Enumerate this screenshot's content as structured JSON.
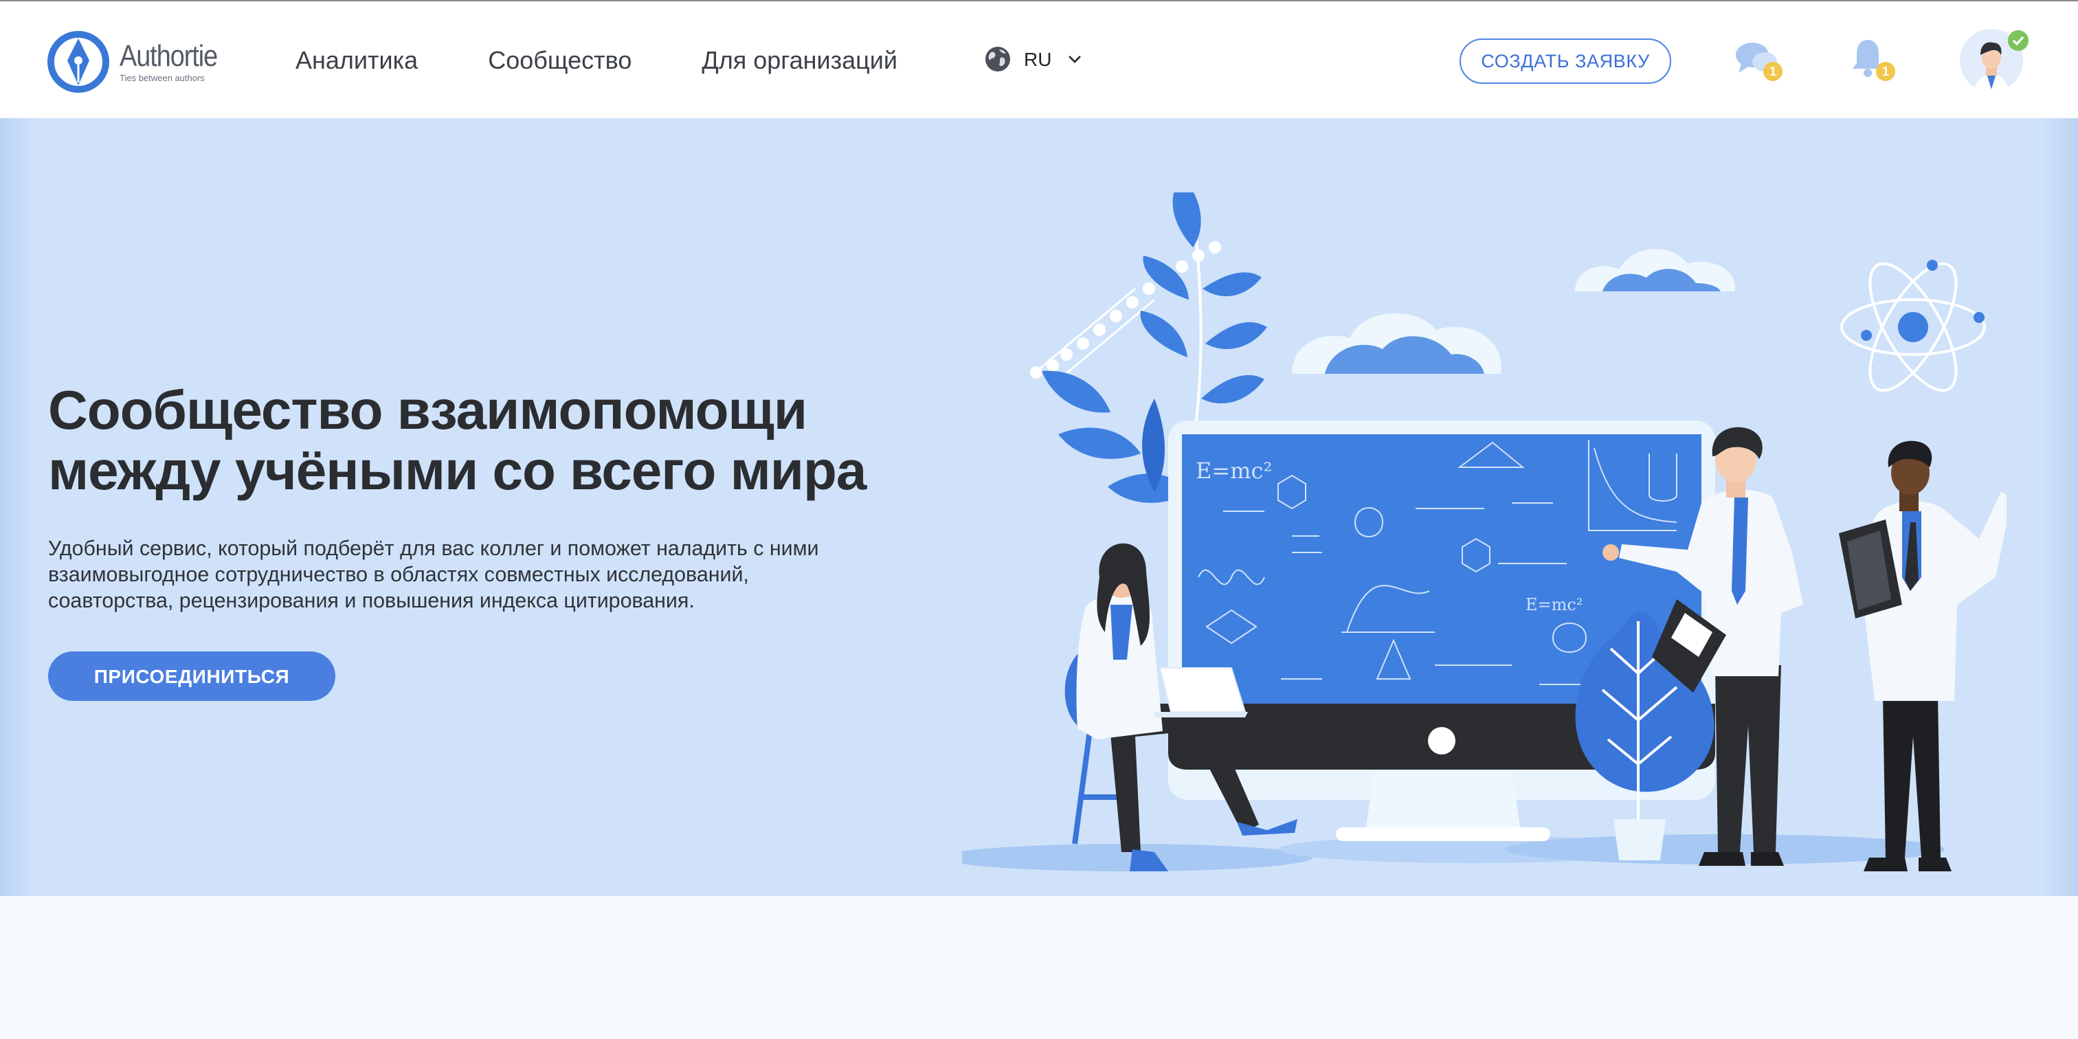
{
  "brand": {
    "name": "Authortie",
    "tagline": "Ties between authors"
  },
  "nav": {
    "items": [
      {
        "label": "Аналитика"
      },
      {
        "label": "Сообщество"
      },
      {
        "label": "Для организаций"
      }
    ]
  },
  "language": {
    "code": "RU",
    "icon": "globe-icon"
  },
  "header": {
    "create_request_label": "СОЗДАТЬ ЗАЯВКУ",
    "messages_count": "1",
    "notifications_count": "1",
    "icons": {
      "messages": "chat-icon",
      "notifications": "bell-icon",
      "profile": "avatar",
      "status": "check-icon"
    }
  },
  "hero": {
    "title_line1": "Сообщество взаимопомощи",
    "title_line2": "между учёными со всего мира",
    "subtitle_line1": "Удобный сервис, который подберёт для вас коллег и поможет наладить с ними",
    "subtitle_line2": "взаимовыгодное сотрудничество в областях совместных исследований,",
    "subtitle_line3": "соавторства, рецензирования и повышения индекса цитирования.",
    "join_label": "ПРИСОЕДИНИТЬСЯ",
    "monitor_formula": "E=mc²"
  },
  "colors": {
    "accent": "#4a7fe0",
    "hero_bg": "#cfe2fa",
    "page_bg": "#f6f9fe",
    "badge": "#f2c54b",
    "verified": "#7cc35a",
    "title": "#2b2d31"
  }
}
